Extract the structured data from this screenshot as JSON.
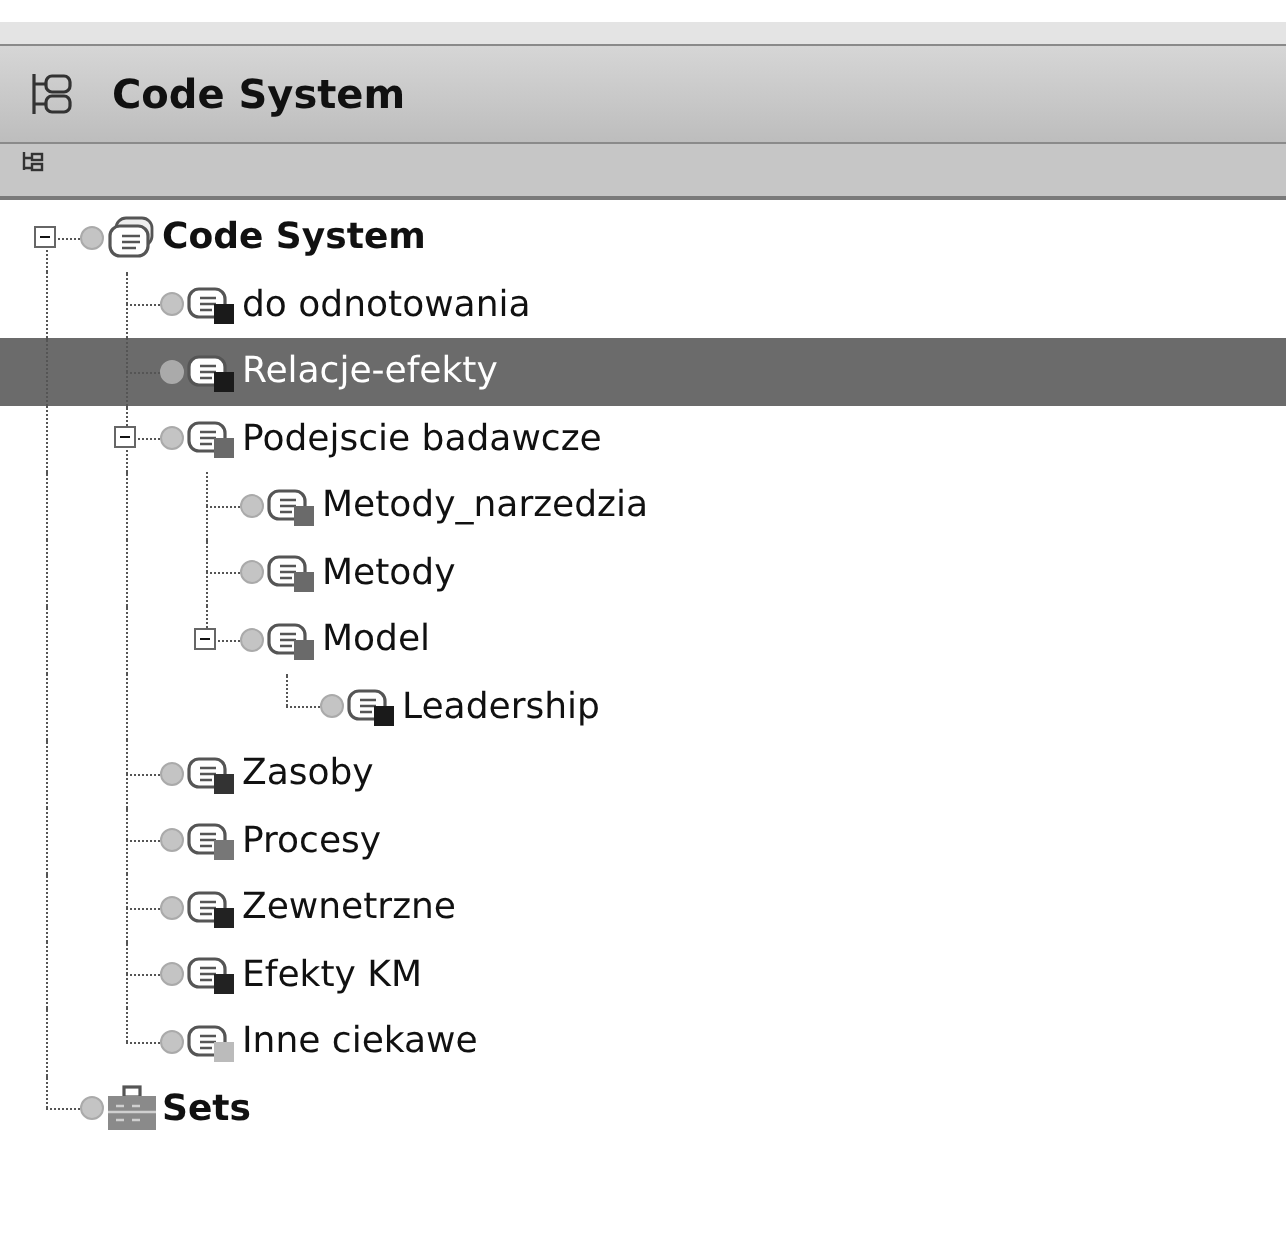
{
  "panel": {
    "title": "Code System"
  },
  "tree": [
    {
      "label": "Code System",
      "kind": "codesystem",
      "selected": false,
      "expanded": true,
      "children": [
        {
          "label": "do odnotowania",
          "kind": "code",
          "color": "#1a1a1a",
          "selected": false
        },
        {
          "label": "Relacje-efekty",
          "kind": "code",
          "color": "#1a1a1a",
          "selected": true
        },
        {
          "label": "Podejscie badawcze",
          "kind": "code",
          "color": "#6a6a6a",
          "selected": false,
          "expanded": true,
          "children": [
            {
              "label": "Metody_narzedzia",
              "kind": "code",
              "color": "#6a6a6a",
              "selected": false
            },
            {
              "label": "Metody",
              "kind": "code",
              "color": "#6a6a6a",
              "selected": false
            },
            {
              "label": "Model",
              "kind": "code",
              "color": "#6a6a6a",
              "selected": false,
              "expanded": true,
              "children": [
                {
                  "label": "Leadership",
                  "kind": "code",
                  "color": "#1a1a1a",
                  "selected": false
                }
              ]
            }
          ]
        },
        {
          "label": "Zasoby",
          "kind": "code",
          "color": "#333333",
          "selected": false
        },
        {
          "label": "Procesy",
          "kind": "code",
          "color": "#777777",
          "selected": false
        },
        {
          "label": "Zewnetrzne",
          "kind": "code",
          "color": "#222222",
          "selected": false
        },
        {
          "label": "Efekty KM",
          "kind": "code",
          "color": "#222222",
          "selected": false
        },
        {
          "label": "Inne ciekawe",
          "kind": "code",
          "color": "#bbbbbb",
          "selected": false
        }
      ]
    },
    {
      "label": "Sets",
      "kind": "set",
      "selected": false
    }
  ]
}
